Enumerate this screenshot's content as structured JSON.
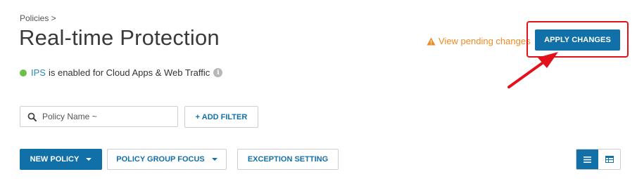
{
  "breadcrumb": "Policies >",
  "title": "Real-time Protection",
  "status": {
    "ips": "IPS",
    "text": " is enabled for Cloud Apps & Web Traffic",
    "info_icon": "info-icon"
  },
  "pending": {
    "icon": "warning-icon",
    "label": "View pending changes"
  },
  "apply": {
    "label": "APPLY CHANGES"
  },
  "search": {
    "placeholder": "Policy Name ~",
    "icon": "search-icon"
  },
  "filter": {
    "label": "+ ADD FILTER"
  },
  "toolbar": {
    "new_policy": "NEW POLICY",
    "group_focus": "POLICY GROUP FOCUS",
    "exception": "EXCEPTION SETTING"
  },
  "view": {
    "list_icon": "list-view-icon",
    "table_icon": "table-view-icon"
  },
  "colors": {
    "accent": "#1270a8",
    "warning": "#f08a24",
    "highlight": "#e3111a",
    "status_ok": "#6cc04a"
  }
}
